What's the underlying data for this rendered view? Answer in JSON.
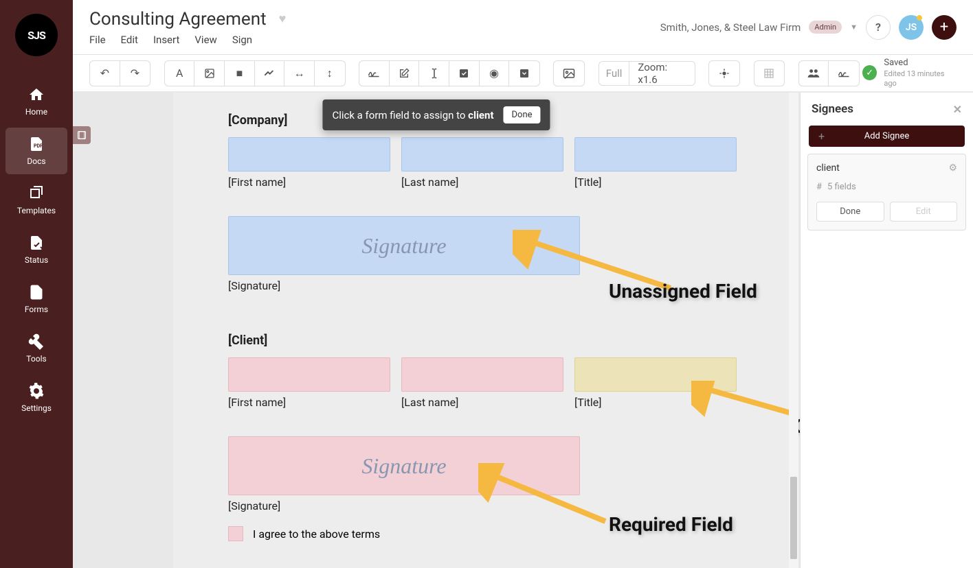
{
  "nav": {
    "logo": "SJS",
    "items": [
      {
        "label": "Home"
      },
      {
        "label": "Docs"
      },
      {
        "label": "Templates"
      },
      {
        "label": "Status"
      },
      {
        "label": "Forms"
      },
      {
        "label": "Tools"
      },
      {
        "label": "Settings"
      }
    ]
  },
  "header": {
    "title": "Consulting Agreement",
    "menus": [
      "File",
      "Edit",
      "Insert",
      "View",
      "Sign"
    ],
    "firm": "Smith, Jones, & Steel Law Firm",
    "role": "Admin",
    "avatar": "JS"
  },
  "toolbar": {
    "zoom_full": "Full",
    "zoom_value": "Zoom: x1.6",
    "saved": "Saved",
    "saved_sub": "Edited 13 minutes ago"
  },
  "assign_bar": {
    "text_pre": "Click a form field to assign to ",
    "target": "client",
    "done": "Done"
  },
  "doc": {
    "sections": [
      {
        "heading": "[Company]",
        "fields": [
          "[First name]",
          "[Last name]",
          "[Title]"
        ],
        "signature_label": "[Signature]",
        "signature_text": "Signature"
      },
      {
        "heading": "[Client]",
        "fields": [
          "[First name]",
          "[Last name]",
          "[Title]"
        ],
        "signature_label": "[Signature]",
        "signature_text": "Signature",
        "checkbox_label": "I agree to the above terms"
      }
    ]
  },
  "annotations": {
    "unassigned": "Unassigned Field",
    "optional": "Optional Field",
    "required": "Required Field"
  },
  "panel": {
    "title": "Signees",
    "add_label": "Add Signee",
    "signee": {
      "name": "client",
      "field_count": "5 fields",
      "done": "Done",
      "edit": "Edit"
    }
  }
}
